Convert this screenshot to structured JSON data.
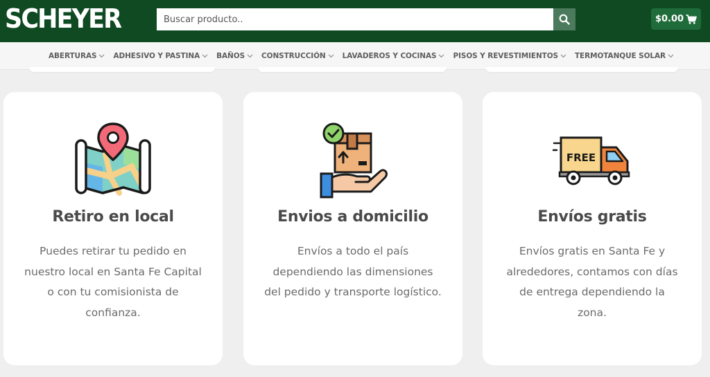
{
  "header": {
    "logo": "SCHEYER",
    "search_placeholder": "Buscar producto..",
    "cart_total": "$0.00"
  },
  "nav": {
    "items": [
      {
        "label": "ABERTURAS"
      },
      {
        "label": "ADHESIVO Y PASTINA"
      },
      {
        "label": "BAÑOS"
      },
      {
        "label": "CONSTRUCCIÓN"
      },
      {
        "label": "LAVADEROS Y COCINAS"
      },
      {
        "label": "PISOS Y REVESTIMIENTOS"
      },
      {
        "label": "TERMOTANQUE SOLAR"
      }
    ]
  },
  "features": [
    {
      "icon": "map-pin-icon",
      "title": "Retiro en local",
      "text": "Puedes retirar tu pedido en nuestro local en Santa Fe Capital o con tu comisionista de confianza."
    },
    {
      "icon": "box-hand-icon",
      "title": "Envios a domicilio",
      "text": "Envíos a todo el país dependiendo las dimensiones del pedido y transporte logístico."
    },
    {
      "icon": "free-truck-icon",
      "title": "Envíos gratis",
      "text": "Envíos gratis en Santa Fe y alrededores, contamos con días de entrega dependiendo la zona.",
      "badge": "FREE"
    }
  ],
  "colors": {
    "header_bg": "#0f4a23",
    "search_button": "#4c7a5c",
    "cart_bg": "#1f6b3a",
    "page_bg": "#efefef"
  }
}
